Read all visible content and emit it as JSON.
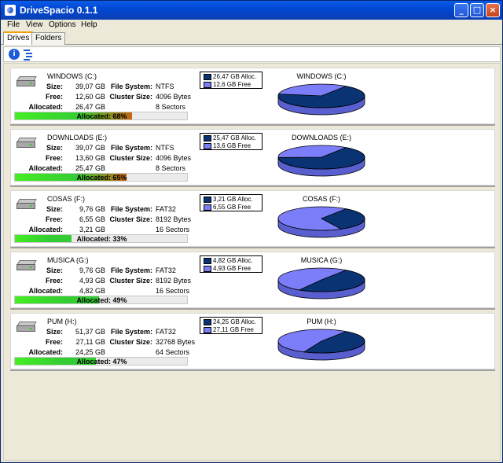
{
  "window": {
    "title": "DriveSpacio 0.1.1",
    "minimize": "_",
    "maximize": "□",
    "close": "×"
  },
  "menu": [
    {
      "label": "File"
    },
    {
      "label": "View"
    },
    {
      "label": "Options"
    },
    {
      "label": "Help"
    }
  ],
  "tabs": [
    {
      "label": "Drives",
      "active": true
    },
    {
      "label": "Folders",
      "active": false
    }
  ],
  "labels": {
    "size": "Size:",
    "free": "Free:",
    "allocated": "Allocated:",
    "file_system": "File System:",
    "cluster_size": "Cluster Size:"
  },
  "colors": {
    "alloc": "#0a3373",
    "free": "#7b7ef8",
    "bar_high": "#c86414",
    "bar_low": "#33cc33"
  },
  "drives": [
    {
      "name": "WINDOWS (C:)",
      "size": "39,07 GB",
      "free": "12,60 GB",
      "allocated": "26,47 GB",
      "file_system": "NTFS",
      "cluster_size": "4096 Bytes",
      "sectors": "8 Sectors",
      "bar_text": "Allocated: 68%",
      "percent": 68,
      "legend_alloc": "26,47 GB Alloc.",
      "legend_free": "12,6 GB Free",
      "chart_title": "WINDOWS (C:)"
    },
    {
      "name": "DOWNLOADS (E:)",
      "size": "39,07 GB",
      "free": "13,60 GB",
      "allocated": "25,47 GB",
      "file_system": "NTFS",
      "cluster_size": "4096 Bytes",
      "sectors": "8 Sectors",
      "bar_text": "Allocated: 65%",
      "percent": 65,
      "legend_alloc": "25,47 GB Alloc.",
      "legend_free": "13,6 GB Free",
      "chart_title": "DOWNLOADS (E:)"
    },
    {
      "name": "COSAS (F:)",
      "size": "9,76 GB",
      "free": "6,55 GB",
      "allocated": "3,21 GB",
      "file_system": "FAT32",
      "cluster_size": "8192 Bytes",
      "sectors": "16 Sectors",
      "bar_text": "Allocated: 33%",
      "percent": 33,
      "legend_alloc": "3,21 GB Alloc.",
      "legend_free": "6,55 GB Free",
      "chart_title": "COSAS (F:)"
    },
    {
      "name": "MUSICA (G:)",
      "size": "9,76 GB",
      "free": "4,93 GB",
      "allocated": "4,82 GB",
      "file_system": "FAT32",
      "cluster_size": "8192 Bytes",
      "sectors": "16 Sectors",
      "bar_text": "Allocated: 49%",
      "percent": 49,
      "legend_alloc": "4,82 GB Alloc.",
      "legend_free": "4,93 GB Free",
      "chart_title": "MUSICA (G:)"
    },
    {
      "name": "PUM (H:)",
      "size": "51,37 GB",
      "free": "27,11 GB",
      "allocated": "24,25 GB",
      "file_system": "FAT32",
      "cluster_size": "32768 Bytes",
      "sectors": "64 Sectors",
      "bar_text": "Allocated: 47%",
      "percent": 47,
      "legend_alloc": "24,25 GB Alloc.",
      "legend_free": "27,11 GB Free",
      "chart_title": "PUM (H:)"
    }
  ]
}
